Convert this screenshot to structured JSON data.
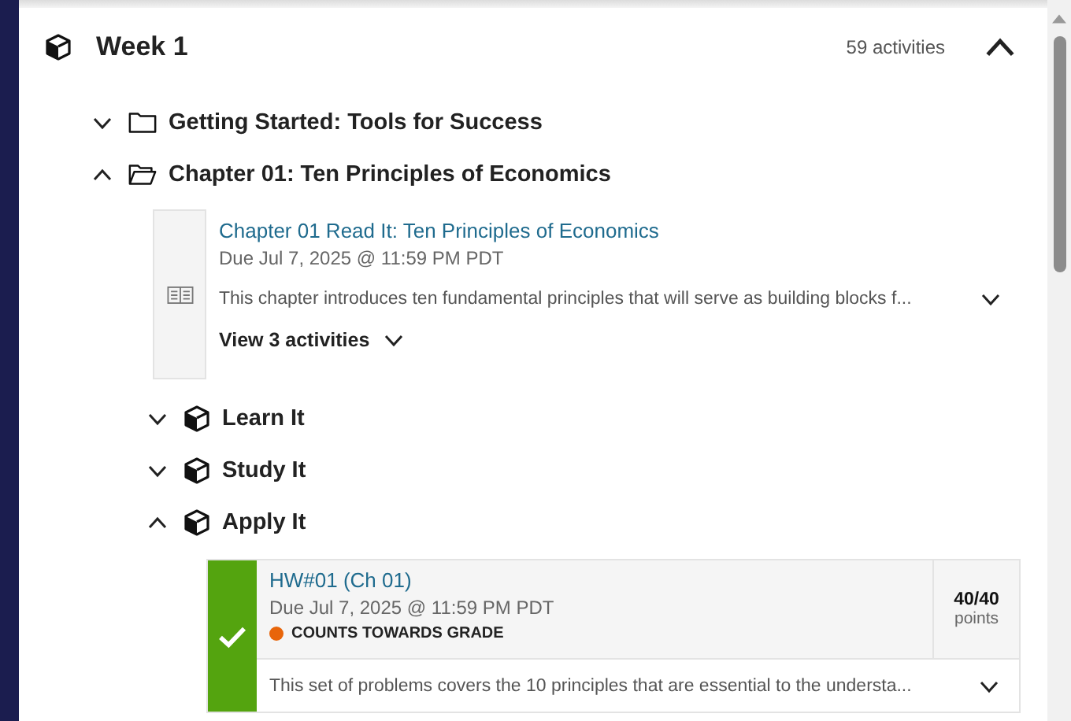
{
  "week": {
    "title": "Week 1",
    "count": "59 activities",
    "expanded": true,
    "items": [
      {
        "kind": "folder",
        "title": "Getting Started: Tools for Success",
        "expanded": false
      },
      {
        "kind": "folder",
        "title": "Chapter 01: Ten Principles of Economics",
        "expanded": true,
        "children": [
          {
            "kind": "reading",
            "title": "Chapter 01 Read It: Ten Principles of Economics",
            "due": "Due Jul 7, 2025 @ 11:59 PM PDT",
            "description": "This chapter introduces ten fundamental principles that will serve as building blocks f...",
            "more": "View 3 activities"
          },
          {
            "kind": "section",
            "title": "Learn It",
            "expanded": false
          },
          {
            "kind": "section",
            "title": "Study It",
            "expanded": false
          },
          {
            "kind": "section",
            "title": "Apply It",
            "expanded": true,
            "children": [
              {
                "kind": "assignment",
                "title": "HW#01 (Ch 01)",
                "due": "Due Jul 7, 2025 @ 11:59 PM PDT",
                "completed": true,
                "tag": {
                  "label": "COUNTS TOWARDS GRADE",
                  "color": "#e8650a"
                },
                "score": "40/40",
                "score_unit": "points",
                "description": "This set of problems covers the 10 principles that are essential to the understa..."
              }
            ]
          }
        ]
      }
    ]
  }
}
